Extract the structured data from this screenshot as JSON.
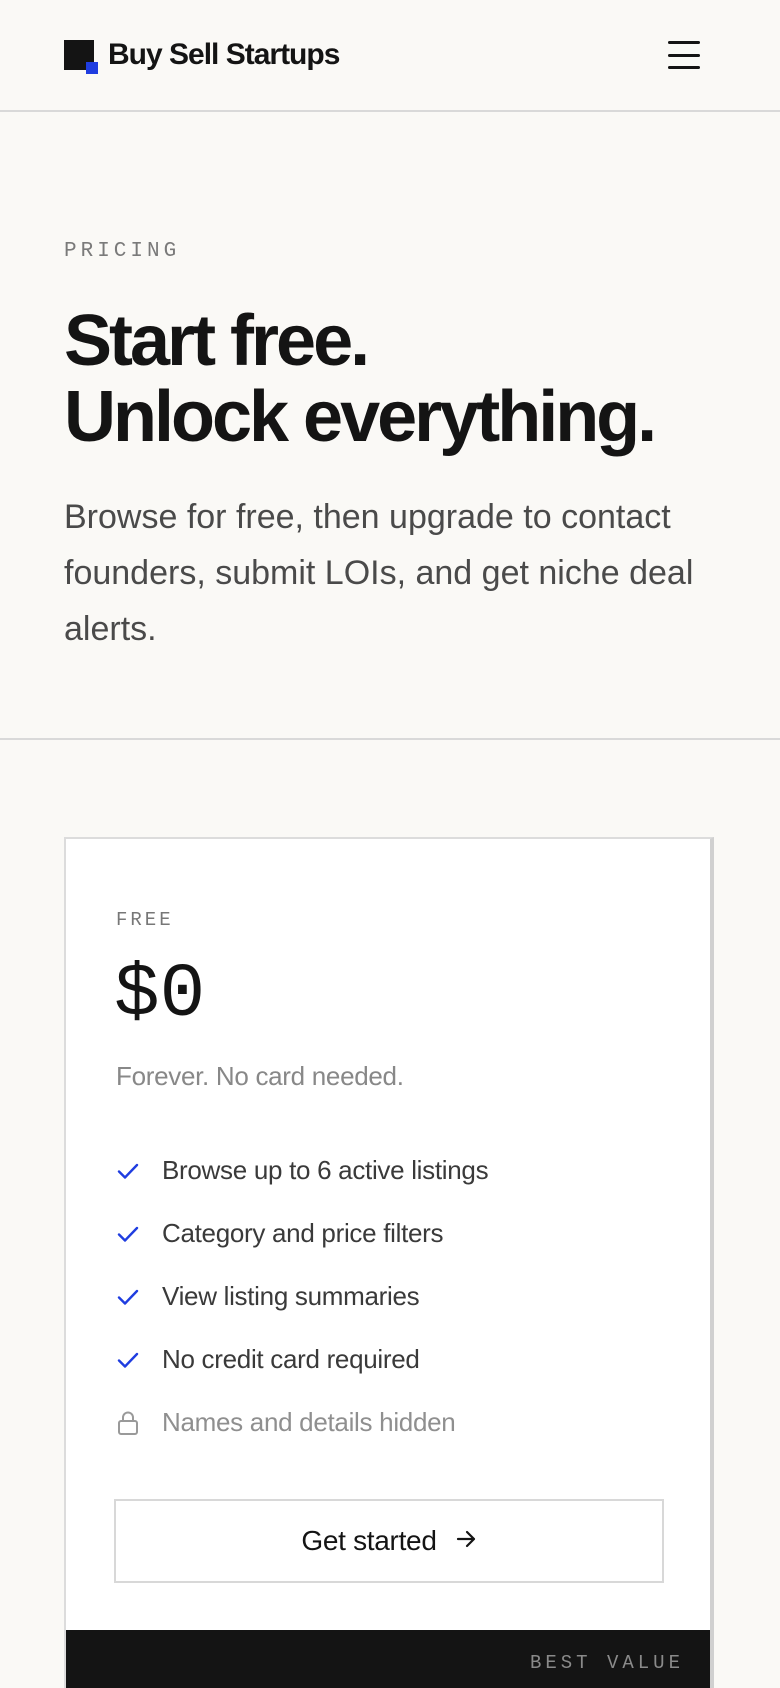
{
  "header": {
    "brand_name": "Buy Sell Startups",
    "menu_icon": "hamburger-menu-icon"
  },
  "hero": {
    "eyebrow": "PRICING",
    "headline_line1": "Start free.",
    "headline_line2": "Unlock everything.",
    "subtitle": "Browse for free, then upgrade to contact founders, submit LOIs, and get niche deal alerts."
  },
  "plan_free": {
    "tier": "FREE",
    "price": "$0",
    "note": "Forever. No card needed.",
    "features": [
      {
        "label": "Browse up to 6 active listings",
        "icon": "check-icon",
        "included": true
      },
      {
        "label": "Category and price filters",
        "icon": "check-icon",
        "included": true
      },
      {
        "label": "View listing summaries",
        "icon": "check-icon",
        "included": true
      },
      {
        "label": "No credit card required",
        "icon": "check-icon",
        "included": true
      },
      {
        "label": "Names and details hidden",
        "icon": "lock-icon",
        "included": false
      }
    ],
    "cta_label": "Get started",
    "cta_icon": "arrow-right-icon"
  },
  "plan_next": {
    "badge": "BEST VALUE"
  },
  "colors": {
    "accent": "#1f3de0",
    "background": "#faf9f6",
    "text": "#141414",
    "muted": "#8f8f8f"
  }
}
